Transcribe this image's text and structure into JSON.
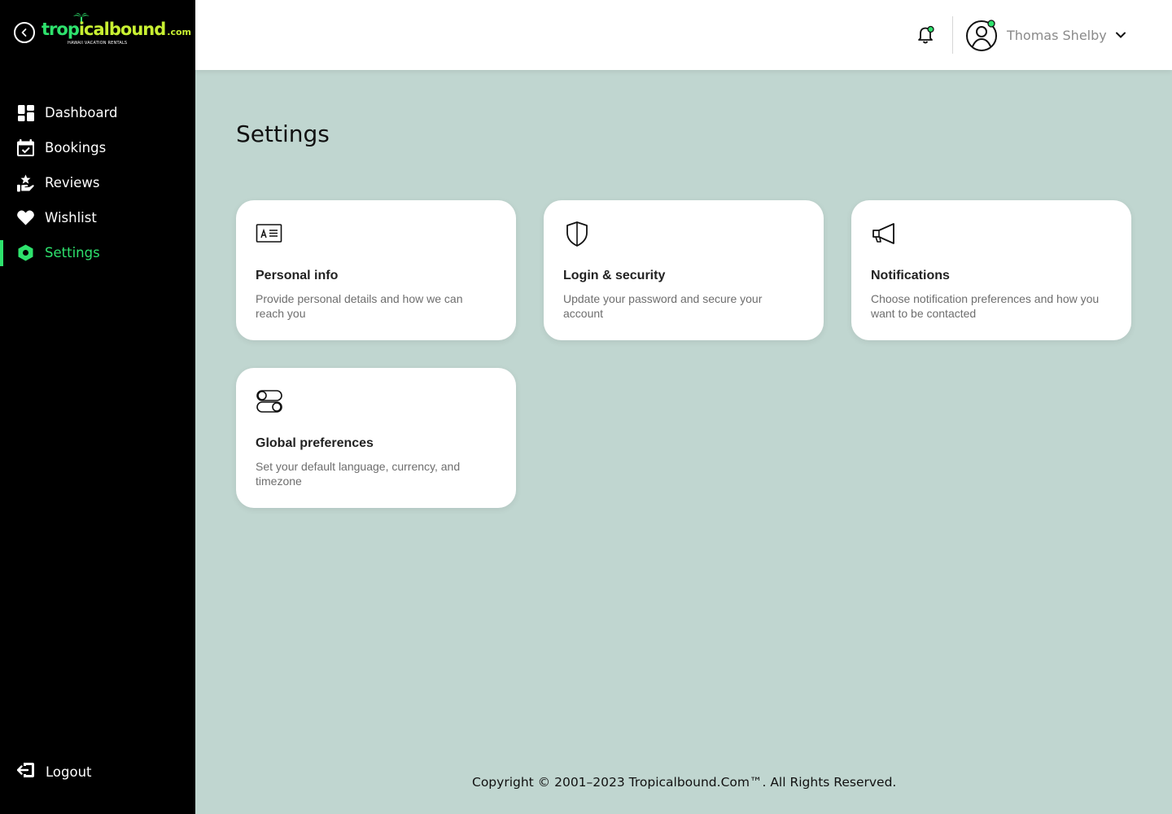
{
  "brand": {
    "logo_main_green": "trop",
    "logo_main_lime": "icalbound",
    "logo_com": ".com",
    "logo_tagline": "HAWAII VACATION RENTALS",
    "accent_green": "#2ee26d",
    "accent_lime": "#c8f032"
  },
  "sidebar": {
    "items": [
      {
        "label": "Dashboard",
        "icon": "dashboard-icon",
        "active": false
      },
      {
        "label": "Bookings",
        "icon": "calendar-check-icon",
        "active": false
      },
      {
        "label": "Reviews",
        "icon": "star-hand-icon",
        "active": false
      },
      {
        "label": "Wishlist",
        "icon": "heart-icon",
        "active": false
      },
      {
        "label": "Settings",
        "icon": "settings-hex-icon",
        "active": true
      }
    ],
    "logout_label": "Logout"
  },
  "header": {
    "user_name": "Thomas Shelby",
    "has_notification": true
  },
  "main": {
    "title": "Settings",
    "cards": [
      {
        "title": "Personal info",
        "description": "Provide personal details and how we can reach you",
        "icon": "id-card-icon"
      },
      {
        "title": "Login & security",
        "description": "Update your password and secure your account",
        "icon": "shield-icon"
      },
      {
        "title": "Notifications",
        "description": "Choose notification preferences and how you want to be contacted",
        "icon": "megaphone-icon"
      },
      {
        "title": "Global preferences",
        "description": "Set your default language, currency, and timezone",
        "icon": "toggles-icon"
      }
    ]
  },
  "footer": {
    "copyright": "Copyright © 2001–2023 Tropicalbound.Com™. All Rights Reserved."
  }
}
